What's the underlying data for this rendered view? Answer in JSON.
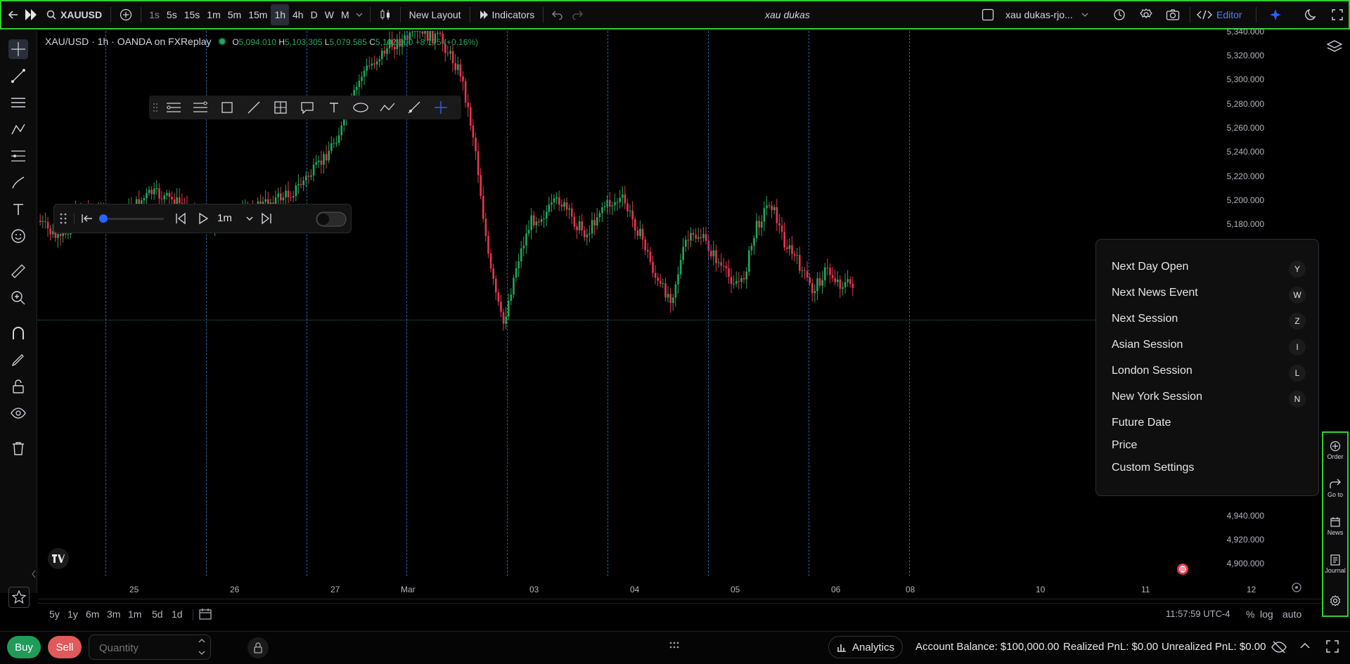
{
  "topbar": {
    "symbol": "XAUUSD",
    "timeframes": [
      "1s",
      "5s",
      "15s",
      "1m",
      "5m",
      "15m",
      "1h",
      "4h",
      "D",
      "W",
      "M"
    ],
    "active_timeframe": "1h",
    "new_layout_label": "New Layout",
    "indicators_label": "Indicators",
    "layout_name": "xau dukas",
    "account_name": "xau dukas-rjo...",
    "editor_label": "Editor"
  },
  "legend": {
    "title": "XAU/USD · 1h · OANDA on FXReplay",
    "open_label": "O",
    "open": "5,094.010",
    "high_label": "H",
    "high": "5,103.305",
    "low_label": "L",
    "low": "5,079.585",
    "close_label": "C",
    "close": "5,102.300",
    "change": "+8.175",
    "change_pct": "(+0.16%)"
  },
  "price_axis": {
    "labels": [
      "5,340.000",
      "5,320.000",
      "5,300.000",
      "5,280.000",
      "5,260.000",
      "5,240.000",
      "5,220.000",
      "5,200.000",
      "5,180.000",
      "4,940.000",
      "4,920.000",
      "4,900.000"
    ]
  },
  "time_axis": {
    "labels": [
      "25",
      "26",
      "27",
      "Mar",
      "03",
      "04",
      "05",
      "06",
      "08",
      "10",
      "11",
      "12"
    ]
  },
  "replay": {
    "speed": "1m"
  },
  "goto_menu": {
    "items": [
      {
        "label": "Next Day Open",
        "key": "Y"
      },
      {
        "label": "Next News Event",
        "key": "W"
      },
      {
        "label": "Next Session",
        "key": "Z"
      },
      {
        "label": "Asian Session",
        "key": "I"
      },
      {
        "label": "London Session",
        "key": "L"
      },
      {
        "label": "New York Session",
        "key": "N"
      },
      {
        "label": "Future Date",
        "key": ""
      },
      {
        "label": "Price",
        "key": ""
      },
      {
        "label": "Custom Settings",
        "key": ""
      }
    ]
  },
  "right_strip": {
    "order": "Order",
    "goto": "Go to",
    "news": "News",
    "journal": "Journal"
  },
  "range_bar": {
    "ranges": [
      "5y",
      "1y",
      "6m",
      "3m",
      "1m",
      "5d",
      "1d"
    ],
    "clock": "11:57:59 UTC-4",
    "pct": "%",
    "log": "log",
    "auto": "auto"
  },
  "order_bar": {
    "buy": "Buy",
    "sell": "Sell",
    "quantity_placeholder": "Quantity",
    "analytics": "Analytics",
    "account_balance": "Account Balance: $100,000.00",
    "realized_pnl": "Realized PnL: $0.00",
    "unrealized_pnl": "Unrealized PnL: $0.00"
  },
  "colors": {
    "up": "#26a65b",
    "down": "#e5364e",
    "accent": "#2962ff",
    "highlight_border": "#2fd02f",
    "buy": "#1f9c59",
    "sell": "#e05a5a"
  }
}
